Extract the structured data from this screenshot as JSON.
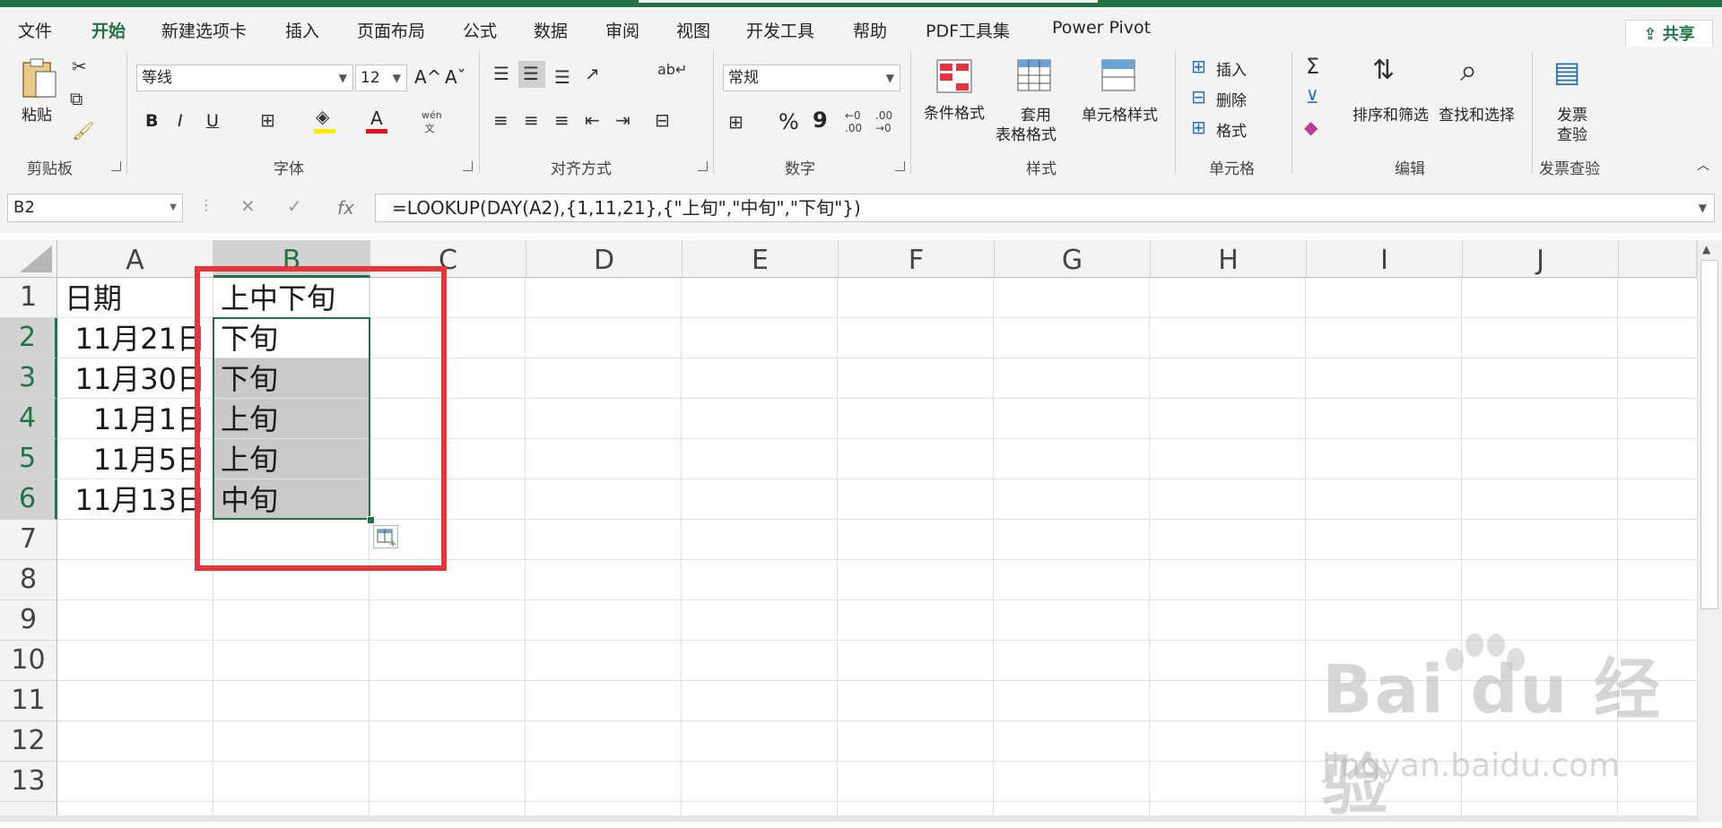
{
  "menu": {
    "tabs": [
      "文件",
      "开始",
      "新建选项卡",
      "插入",
      "页面布局",
      "公式",
      "数据",
      "审阅",
      "视图",
      "开发工具",
      "帮助",
      "PDF工具集",
      "Power Pivot"
    ],
    "share_label": "共享"
  },
  "ribbon": {
    "clipboard": {
      "paste": "粘贴",
      "group": "剪贴板"
    },
    "font": {
      "name": "等线",
      "size": "12",
      "bold": "B",
      "italic": "I",
      "underline": "U",
      "grow": "A^",
      "shrink": "Aˇ",
      "group": "字体"
    },
    "alignment": {
      "group": "对齐方式"
    },
    "number": {
      "format": "常规",
      "percent": "%",
      "comma": "9",
      "group": "数字"
    },
    "styles": {
      "conditional": "条件格式",
      "table_line1": "套用",
      "table_line2": "表格格式",
      "cell_styles": "单元格样式",
      "group": "样式"
    },
    "cells": {
      "insert": "插入",
      "delete": "删除",
      "format": "格式",
      "group": "单元格"
    },
    "editing": {
      "sort": "排序和筛选",
      "find": "查找和选择",
      "group": "编辑"
    },
    "invoice": {
      "line1": "发票",
      "line2": "查验",
      "group": "发票查验"
    }
  },
  "formula_bar": {
    "name_box": "B2",
    "formula": "=LOOKUP(DAY(A2),{1,11,21},{\"上旬\",\"中旬\",\"下旬\"})",
    "fx": "fx"
  },
  "sheet": {
    "columns": [
      "A",
      "B",
      "C",
      "D",
      "E",
      "F",
      "G",
      "H",
      "I",
      "J"
    ],
    "rows": [
      "1",
      "2",
      "3",
      "4",
      "5",
      "6",
      "7",
      "8",
      "9",
      "10",
      "11",
      "12",
      "13"
    ],
    "cells": {
      "A1": "日期",
      "B1": "上中下旬",
      "A2": "11月21日",
      "B2": "下旬",
      "A3": "11月30日",
      "B3": "下旬",
      "A4": "11月1日",
      "B4": "上旬",
      "A5": "11月5日",
      "B5": "上旬",
      "A6": "11月13日",
      "B6": "中旬"
    }
  },
  "watermark": {
    "brand": "Bai du 经验",
    "url": "jingyan.baidu.com"
  },
  "colors": {
    "accent": "#217346",
    "highlight_box": "#e8333b"
  }
}
